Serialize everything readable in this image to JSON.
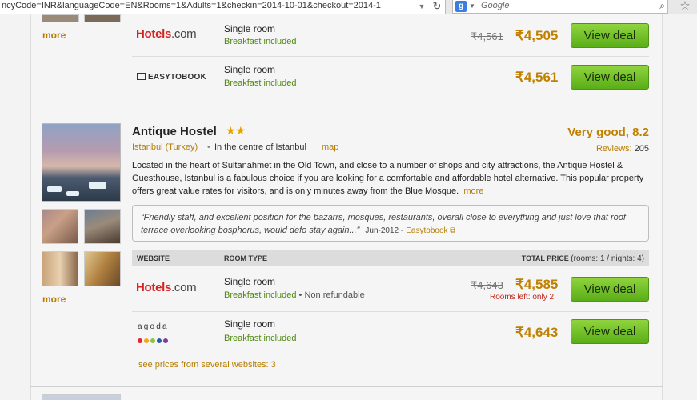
{
  "browser": {
    "url": "ncyCode=INR&languageCode=EN&Rooms=1&Adults=1&checkin=2014-10-01&checkout=2014-1",
    "search_engine": "Google",
    "search_placeholder": "Google"
  },
  "prev_hotel": {
    "more_label": "more",
    "offers": [
      {
        "provider": "Hotels.com",
        "room_type": "Single room",
        "breakfast": "Breakfast included",
        "old_price": "₹4,561",
        "price": "₹4,505",
        "button": "View deal"
      },
      {
        "provider": "EASYTOBOOK",
        "room_type": "Single room",
        "breakfast": "Breakfast included",
        "price": "₹4,561",
        "button": "View deal"
      }
    ]
  },
  "hostel": {
    "name": "Antique Hostel",
    "stars": "★★",
    "city": "Istanbul (Turkey)",
    "area": "In the centre of Istanbul",
    "map_label": "map",
    "rating": "Very good, 8.2",
    "reviews_label": "Reviews:",
    "reviews_count": "205",
    "description": "Located in the heart of Sultanahmet in the Old Town, and close to a number of shops and city attractions, the Antique Hostel & Guesthouse, Istanbul is a fabulous choice if you are looking for a comfortable and affordable hotel alternative. This popular property offers great value rates for visitors, and is only minutes away from the Blue Mosque.",
    "description_more": "more",
    "more_label": "more",
    "quote": "“Friendly staff, and excellent position for the bazarrs, mosques, restaurants, overall close to everything and just love that roof terrace overlooking bosphorus, would defo stay again...”",
    "quote_date": "Jun-2012 -",
    "quote_source": "Easytobook",
    "table": {
      "col_website": "WEBSITE",
      "col_room": "ROOM TYPE",
      "col_total": "TOTAL PRICE",
      "col_total_sub": "(rooms: 1 / nights: 4)"
    },
    "offers": [
      {
        "provider": "Hotels.com",
        "room_type": "Single room",
        "breakfast": "Breakfast included",
        "refund": "Non refundable",
        "old_price": "₹4,643",
        "price": "₹4,585",
        "rooms_left": "Rooms left: only 2!",
        "button": "View deal"
      },
      {
        "provider": "agoda",
        "room_type": "Single room",
        "breakfast": "Breakfast included",
        "price": "₹4,643",
        "button": "View deal"
      }
    ],
    "see_prices": "see prices from several websites: 3"
  },
  "colors": {
    "price": "#c08000",
    "link": "#b57c00",
    "green_button": "#6cc020",
    "breakfast": "#4f8a10",
    "hotels_red": "#d32323"
  }
}
